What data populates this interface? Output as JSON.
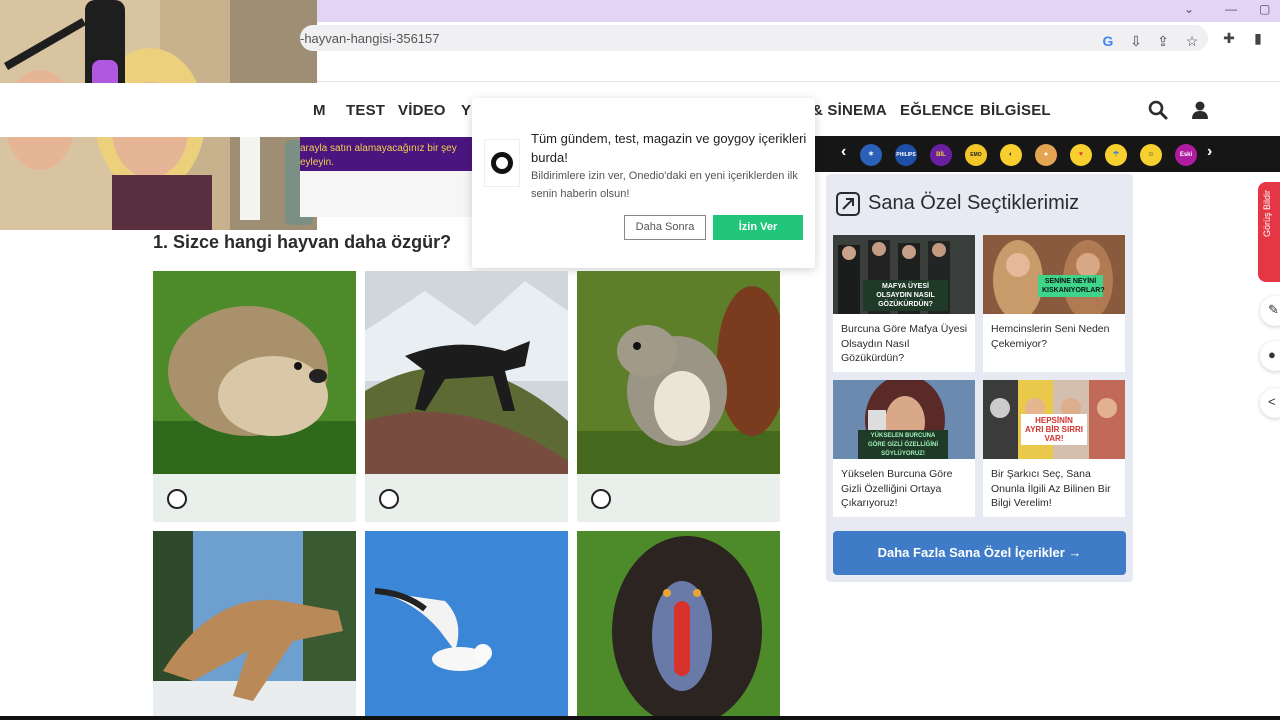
{
  "browser": {
    "url": "-hayvan-hangisi-356157",
    "window_controls": [
      "⌄",
      "—",
      "▢"
    ]
  },
  "nav": {
    "items": [
      "M",
      "TEST",
      "VİDEO",
      "YI",
      "& SİNEMA",
      "EĞLENCE",
      "BİLGİSEL"
    ]
  },
  "promo": {
    "text": "arayla satın alamayacağınız bir şey eyleyin."
  },
  "emoji_strip": {
    "badges": [
      "PHILIPS",
      "BİL POP",
      "EMO JİLE",
      "Eski"
    ]
  },
  "notification": {
    "title": "Tüm gündem, test, magazin ve goygoy içerikleri burda!",
    "body": "Bildirimlere izin ver, Onedio'daki en yeni içeriklerden ilk senin haberin olsun!",
    "later_label": "Daha Sonra",
    "allow_label": "İzin Ver"
  },
  "question": {
    "title": "1. Sizce hangi hayvan daha özgür?"
  },
  "recommend": {
    "title": "Sana Özel Seçtiklerimiz",
    "cards": [
      {
        "title": "Burcuna Göre Mafya Üyesi Olsaydın Nasıl Gözükürdün?",
        "badge": "MAFYA ÜYESİ OLSAYDIN NASIL GÖZÜKÜRDÜN?"
      },
      {
        "title": "Hemcinslerin Seni Neden Çekemiyor?",
        "badge": "SENİNE NEYİNİ KISKANIYORLAR?"
      },
      {
        "title": "Yükselen Burcuna Göre Gizli Özelliğini Ortaya Çıkarıyoruz!",
        "badge": "YÜKSELEN BURCUNA GÖRE GİZLİ ÖZELLİĞİNİ SÖYLÜYORUZ!"
      },
      {
        "title": "Bir Şarkıcı Seç, Sana Onunla İlgili Az Bilinen Bir Bilgi Verelim!",
        "badge": "HEPSİNİN AYRI BİR SIRRI VAR!"
      }
    ],
    "more_label": "Daha Fazla Sana Özel İçerikler →"
  },
  "side": {
    "red_label": "Görüş Bildir"
  }
}
